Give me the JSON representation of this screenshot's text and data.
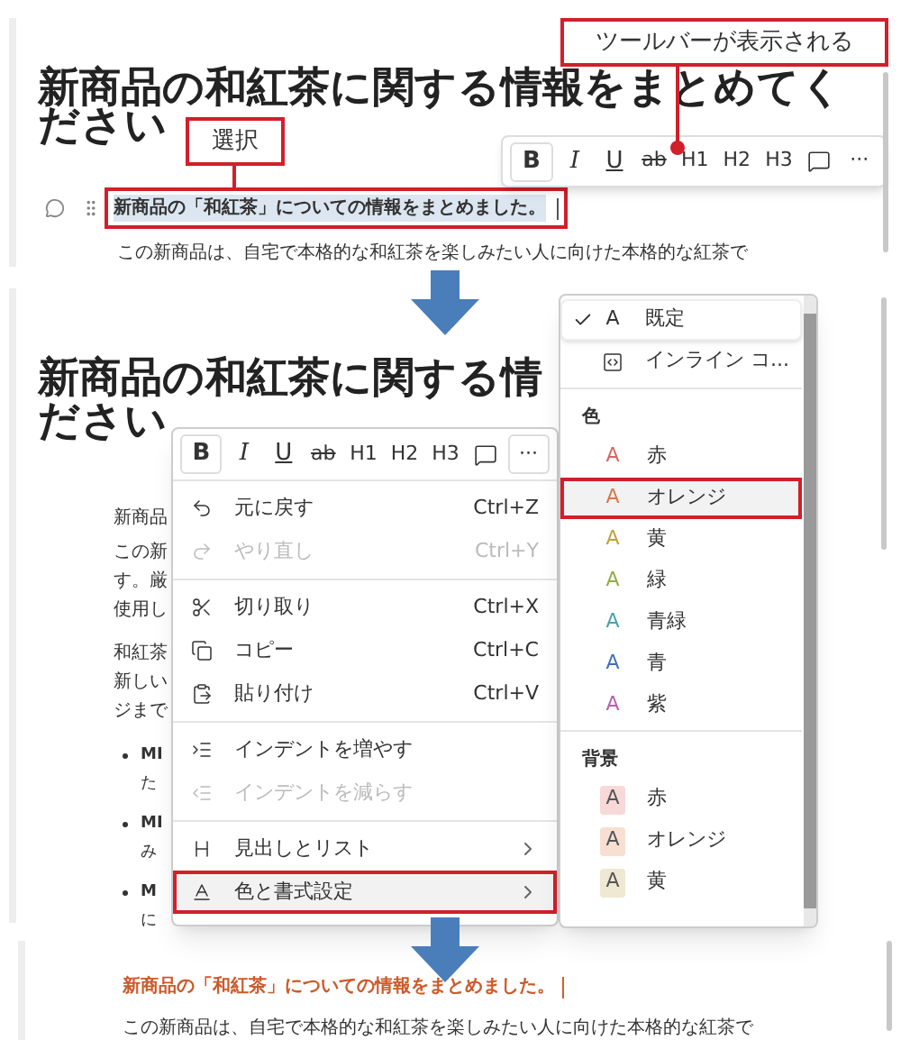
{
  "step1": {
    "title_lines": [
      "新商品の和紅茶に関する情報をまとめてく",
      "ださい"
    ],
    "toolbar": [
      {
        "kind": "bold",
        "label": "B"
      },
      {
        "kind": "italic",
        "label": "I"
      },
      {
        "kind": "underline",
        "label": "U"
      },
      {
        "kind": "strike",
        "label": "ab"
      },
      {
        "kind": "text",
        "label": "H1"
      },
      {
        "kind": "text",
        "label": "H2"
      },
      {
        "kind": "text",
        "label": "H3"
      },
      {
        "kind": "comment"
      },
      {
        "kind": "text",
        "label": "···"
      }
    ],
    "selected_text": {
      "text": "新商品の「和紅茶」についての情報をまとめました。",
      "selected": true
    },
    "body_line": "この新商品は、自宅で本格的な和紅茶を楽しみたい人に向けた本格的な紅茶で",
    "callouts": [
      {
        "text": "ツールバーが表示される"
      },
      {
        "text": "選択"
      }
    ]
  },
  "step2": {
    "title_lines": [
      "新商品の和紅茶に関する情",
      "ださい"
    ],
    "paragraphs": [
      [
        "新商品"
      ],
      [
        "この新",
        "す。厳",
        "使用し"
      ],
      [
        "和紅茶",
        "新しい",
        "ジまで"
      ]
    ],
    "bullets": [
      {
        "bold": "MI",
        "rest": "た"
      },
      {
        "bold": "MI",
        "rest": "み"
      },
      {
        "bold": "M",
        "rest": "に"
      }
    ],
    "toolbar": [
      {
        "kind": "bold",
        "label": "B"
      },
      {
        "kind": "italic",
        "label": "I"
      },
      {
        "kind": "underline",
        "label": "U"
      },
      {
        "kind": "strike",
        "label": "ab"
      },
      {
        "kind": "text",
        "label": "H1"
      },
      {
        "kind": "text",
        "label": "H2"
      },
      {
        "kind": "text",
        "label": "H3"
      },
      {
        "kind": "comment"
      },
      {
        "kind": "more",
        "label": "···"
      }
    ],
    "menu": [
      [
        {
          "kind": "undo",
          "label": "元に戻す",
          "shortcut": "Ctrl+Z",
          "disabled": false,
          "highlighted": false
        },
        {
          "kind": "redo",
          "label": "やり直し",
          "shortcut": "Ctrl+Y",
          "disabled": true,
          "highlighted": false
        }
      ],
      [
        {
          "kind": "cut",
          "label": "切り取り",
          "shortcut": "Ctrl+X",
          "disabled": false,
          "highlighted": false
        },
        {
          "kind": "copy",
          "label": "コピー",
          "shortcut": "Ctrl+C",
          "disabled": false,
          "highlighted": false
        },
        {
          "kind": "paste",
          "label": "貼り付け",
          "shortcut": "Ctrl+V",
          "disabled": false,
          "highlighted": false
        }
      ],
      [
        {
          "kind": "indent",
          "label": "インデントを増やす",
          "disabled": false,
          "highlighted": false
        },
        {
          "kind": "outdent",
          "label": "インデントを減らす",
          "disabled": true,
          "highlighted": false
        }
      ],
      [
        {
          "kind": "heading",
          "label": "見出しとリスト",
          "submenu": true,
          "disabled": false,
          "highlighted": false
        },
        {
          "kind": "format",
          "label": "色と書式設定",
          "submenu": true,
          "disabled": false,
          "highlighted": true
        }
      ]
    ],
    "submenu": {
      "top": [
        {
          "kind": "default",
          "glyph": "A",
          "label": "既定",
          "checked": true
        },
        {
          "kind": "code",
          "label": "インライン コ...",
          "checked": false
        }
      ],
      "sections": [
        {
          "title": "色",
          "kind": "text",
          "items": [
            {
              "glyph": "A",
              "label": "赤",
              "color": "#d9645f",
              "highlighted": false
            },
            {
              "glyph": "A",
              "label": "オレンジ",
              "color": "#d9774a",
              "highlighted": true
            },
            {
              "glyph": "A",
              "label": "黄",
              "color": "#bfa23c",
              "highlighted": false
            },
            {
              "glyph": "A",
              "label": "緑",
              "color": "#8fae44",
              "highlighted": false
            },
            {
              "glyph": "A",
              "label": "青緑",
              "color": "#4aa0a8",
              "highlighted": false
            },
            {
              "glyph": "A",
              "label": "青",
              "color": "#3f6fb5",
              "highlighted": false
            },
            {
              "glyph": "A",
              "label": "紫",
              "color": "#b55fb0",
              "highlighted": false
            }
          ]
        },
        {
          "title": "背景",
          "kind": "background",
          "items": [
            {
              "glyph": "A",
              "label": "赤",
              "color": "#f7d9d9",
              "highlighted": false
            },
            {
              "glyph": "A",
              "label": "オレンジ",
              "color": "#f9dfd2",
              "highlighted": false
            },
            {
              "glyph": "A",
              "label": "黄",
              "color": "#efe8d2",
              "highlighted": false
            }
          ]
        }
      ]
    }
  },
  "step3": {
    "heading": {
      "text": "新商品の「和紅茶」についての情報をまとめました。",
      "color": "#cc5a2a"
    },
    "body_line": "この新商品は、自宅で本格的な和紅茶を楽しみたい人に向けた本格的な紅茶で"
  }
}
